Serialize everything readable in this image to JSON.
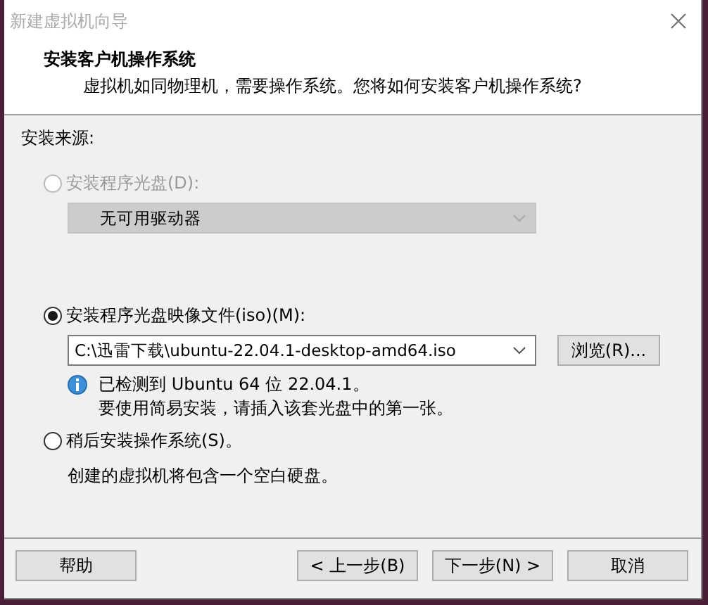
{
  "window": {
    "title": "新建虚拟机向导"
  },
  "header": {
    "title": "安装客户机操作系统",
    "subtitle": "虚拟机如同物理机，需要操作系统。您将如何安装客户机操作系统?"
  },
  "source_label": "安装来源:",
  "options": [
    {
      "label": "安装程序光盘(D):",
      "selected": false,
      "disabled": true,
      "dropdown": {
        "value": "无可用驱动器",
        "disabled": true
      }
    },
    {
      "label": "安装程序光盘映像文件(iso)(M):",
      "selected": true,
      "disabled": false,
      "dropdown": {
        "value": "C:\\迅雷下载\\ubuntu-22.04.1-desktop-amd64.iso",
        "disabled": false
      },
      "browse": "浏览(R)...",
      "info": [
        "已检测到 Ubuntu 64 位 22.04.1。",
        "要使用简易安装，请插入该套光盘中的第一张。"
      ]
    },
    {
      "label": "稍后安装操作系统(S)。",
      "selected": false,
      "disabled": false,
      "note": "创建的虚拟机将包含一个空白硬盘。"
    }
  ],
  "buttons": [
    {
      "label": "帮助",
      "kind": "left"
    },
    {
      "label": "< 上一步(B)",
      "kind": "right"
    },
    {
      "label": "下一步(N) >",
      "kind": "right"
    },
    {
      "label": "取消",
      "kind": "right"
    }
  ]
}
